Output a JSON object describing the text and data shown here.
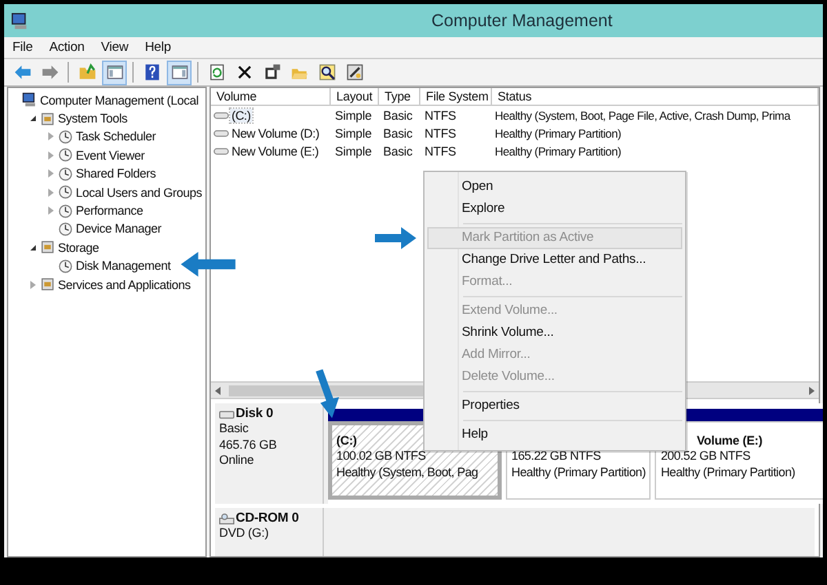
{
  "window": {
    "title": "Computer Management"
  },
  "menu_bar": [
    "File",
    "Action",
    "View",
    "Help"
  ],
  "toolbar": [
    {
      "kind": "button",
      "pressed": false
    },
    {
      "kind": "button",
      "pressed": false
    },
    {
      "kind": "separator"
    },
    {
      "kind": "button",
      "pressed": false
    },
    {
      "kind": "button",
      "pressed": true
    },
    {
      "kind": "separator"
    },
    {
      "kind": "button",
      "pressed": false
    },
    {
      "kind": "button",
      "pressed": true
    },
    {
      "kind": "separator"
    },
    {
      "kind": "button",
      "pressed": false
    },
    {
      "kind": "button",
      "pressed": false
    },
    {
      "kind": "button",
      "pressed": false
    },
    {
      "kind": "button",
      "pressed": false
    },
    {
      "kind": "button",
      "pressed": false
    },
    {
      "kind": "button",
      "pressed": false
    }
  ],
  "tree": [
    {
      "label": "Computer Management (Local",
      "children": [
        {
          "label": "System Tools",
          "expanded": true,
          "children": [
            {
              "label": "Task Scheduler",
              "expanded": false
            },
            {
              "label": "Event Viewer",
              "expanded": false
            },
            {
              "label": "Shared Folders",
              "expanded": false
            },
            {
              "label": "Local Users and Groups",
              "expanded": false
            },
            {
              "label": "Performance",
              "expanded": false
            },
            {
              "label": "Device Manager"
            }
          ]
        },
        {
          "label": "Storage",
          "expanded": true,
          "children": [
            {
              "label": "Disk Management"
            }
          ]
        },
        {
          "label": "Services and Applications",
          "expanded": false
        }
      ]
    }
  ],
  "volume_table": {
    "columns": [
      "Volume",
      "Layout",
      "Type",
      "File System",
      "Status"
    ],
    "rows": [
      {
        "cells": [
          "(C:)",
          "Simple",
          "Basic",
          "NTFS",
          "Healthy (System, Boot, Page File, Active, Crash Dump, Prima"
        ],
        "selected": true
      },
      {
        "cells": [
          "New Volume (D:)",
          "Simple",
          "Basic",
          "NTFS",
          "Healthy (Primary Partition)"
        ],
        "selected": false
      },
      {
        "cells": [
          "New Volume (E:)",
          "Simple",
          "Basic",
          "NTFS",
          "Healthy (Primary Partition)"
        ],
        "selected": false
      }
    ]
  },
  "disks": [
    {
      "name": "Disk 0",
      "lines": [
        "Basic",
        "465.76 GB",
        "Online"
      ],
      "partitions": [
        {
          "name": "(C:)",
          "size": "100.02 GB NTFS",
          "status": "Healthy (System, Boot, Pag",
          "selected": true
        },
        {
          "size": "165.22 GB NTFS",
          "status": "Healthy (Primary Partition)",
          "selected": false
        },
        {
          "name": "Volume  (E:)",
          "size": "200.52 GB NTFS",
          "status": "Healthy (Primary Partition)",
          "selected": false
        }
      ]
    },
    {
      "name": "CD-ROM 0",
      "lines": [
        "DVD (G:)"
      ]
    }
  ],
  "context_menu": [
    {
      "kind": "item",
      "label": "Open",
      "disabled": false,
      "selected": false
    },
    {
      "kind": "item",
      "label": "Explore",
      "disabled": false,
      "selected": false
    },
    {
      "kind": "separator"
    },
    {
      "kind": "item",
      "label": "Mark Partition as Active",
      "disabled": true,
      "selected": true
    },
    {
      "kind": "item",
      "label": "Change Drive Letter and Paths...",
      "disabled": false,
      "selected": false
    },
    {
      "kind": "item",
      "label": "Format...",
      "disabled": true,
      "selected": false
    },
    {
      "kind": "separator"
    },
    {
      "kind": "item",
      "label": "Extend Volume...",
      "disabled": true,
      "selected": false
    },
    {
      "kind": "item",
      "label": "Shrink Volume...",
      "disabled": false,
      "selected": false
    },
    {
      "kind": "item",
      "label": "Add Mirror...",
      "disabled": true,
      "selected": false
    },
    {
      "kind": "item",
      "label": "Delete Volume...",
      "disabled": true,
      "selected": false
    },
    {
      "kind": "separator"
    },
    {
      "kind": "item",
      "label": "Properties",
      "disabled": false,
      "selected": false
    },
    {
      "kind": "separator"
    },
    {
      "kind": "item",
      "label": "Help",
      "disabled": false,
      "selected": false
    }
  ]
}
